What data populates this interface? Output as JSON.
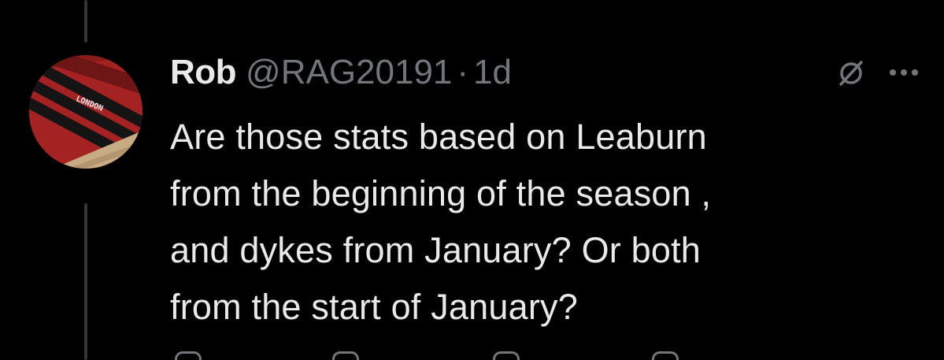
{
  "tweet": {
    "author_name": "Rob",
    "handle": "@RAG20191",
    "separator": "·",
    "time": "1d",
    "text": "Are those stats based on Leaburn\nfrom the beginning of the season ,\nand dykes from January?  Or both\nfrom the start of January?"
  },
  "avatar": {
    "shoe_text": "LONDON",
    "colors": {
      "suede": "#a52222",
      "stripes": "#141414",
      "sole": "#c7ab84"
    }
  },
  "icons": {
    "grok": "grok-slash-circle-icon",
    "more": "more-horizontal-icon",
    "actions": [
      "reply-icon",
      "repost-icon",
      "like-icon",
      "views-icon"
    ]
  },
  "colors": {
    "background": "#000000",
    "primary_text": "#e7e9ea",
    "secondary_text": "#71767b",
    "thread_line": "#333639"
  }
}
